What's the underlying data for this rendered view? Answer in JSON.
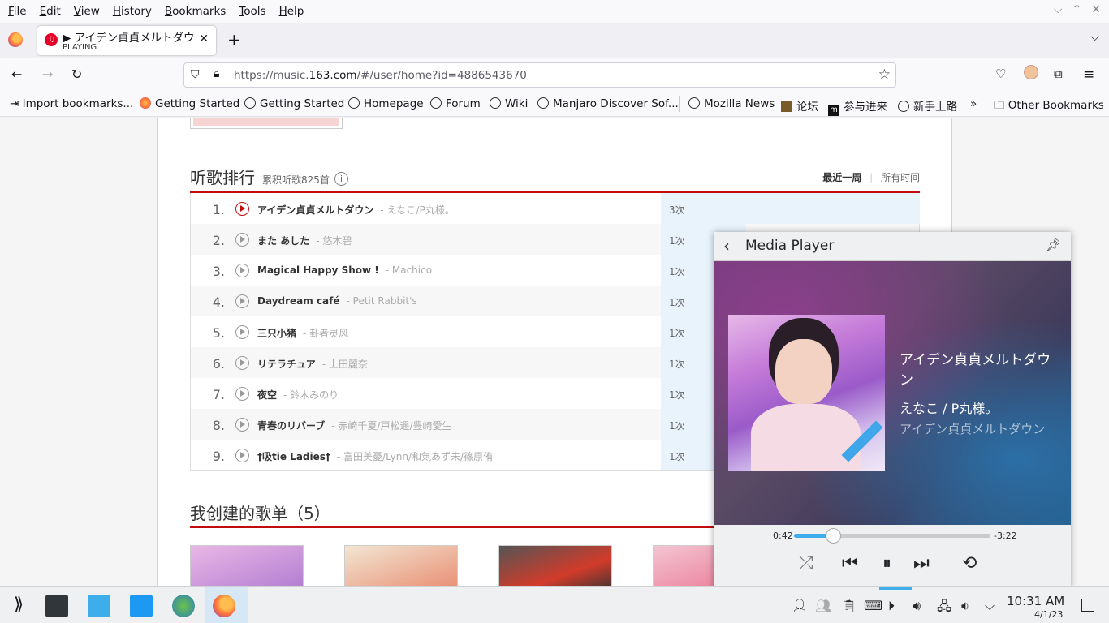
{
  "menubar": {
    "items": [
      "File",
      "Edit",
      "View",
      "History",
      "Bookmarks",
      "Tools",
      "Help"
    ],
    "underline": [
      "F",
      "E",
      "V",
      "H",
      "B",
      "T",
      "H"
    ]
  },
  "tab": {
    "title": "▶ アイデン貞貞メルトダウン",
    "subtitle": "PLAYING",
    "favicon": "netease-music-icon"
  },
  "navbar": {
    "url_prefix": "https://music.",
    "url_domain": "163.com",
    "url_path": "/#/user/home?id=4886543670"
  },
  "bookmarks": [
    {
      "label": "Import bookmarks...",
      "icon": "import-icon"
    },
    {
      "label": "Getting Started",
      "icon": "firefox-icon"
    },
    {
      "label": "Getting Started",
      "icon": "globe-icon"
    },
    {
      "label": "Homepage",
      "icon": "globe-icon"
    },
    {
      "label": "Forum",
      "icon": "globe-icon"
    },
    {
      "label": "Wiki",
      "icon": "globe-icon"
    },
    {
      "label": "Manjaro Discover Sof...",
      "icon": "globe-icon"
    },
    {
      "label": "Mozilla News",
      "icon": "globe-icon"
    },
    {
      "label": "论坛",
      "icon": "box-icon"
    },
    {
      "label": "参与进来",
      "icon": "m-icon"
    },
    {
      "label": "新手上路",
      "icon": "globe-icon"
    },
    {
      "label": "Other Bookmarks",
      "icon": "folder-icon"
    }
  ],
  "ranking": {
    "title": "听歌排行",
    "meta": "累积听歌825首",
    "info": "i",
    "period_active": "最近一周",
    "period_sep": "|",
    "period_other": "所有时间",
    "rows": [
      {
        "num": "1.",
        "song": "アイデン貞貞メルトダウン",
        "artist": "- えなこ/P丸様。",
        "count": "3次",
        "share": 1.0
      },
      {
        "num": "2.",
        "song": "また あした",
        "artist": "- 悠木碧",
        "count": "1次",
        "share": 0.33
      },
      {
        "num": "3.",
        "song": "Magical Happy Show !",
        "artist": "- Machico",
        "count": "1次",
        "share": 0.33
      },
      {
        "num": "4.",
        "song": "Daydream café",
        "artist": "- Petit Rabbit's",
        "count": "1次",
        "share": 0.33
      },
      {
        "num": "5.",
        "song": "三只小猪",
        "artist": "- 卦者灵风",
        "count": "1次",
        "share": 0.33
      },
      {
        "num": "6.",
        "song": "リテラチュア",
        "artist": "- 上田麗奈",
        "count": "1次",
        "share": 0.33
      },
      {
        "num": "7.",
        "song": "夜空",
        "artist": "- 鈴木みのり",
        "count": "1次",
        "share": 0.33
      },
      {
        "num": "8.",
        "song": "青春のリバーブ",
        "artist": "- 赤崎千夏/戸松遥/豊崎愛生",
        "count": "1次",
        "share": 0.33
      },
      {
        "num": "9.",
        "song": "†吸tie Ladies†",
        "artist": "- 富田美憂/Lynn/和氣あず未/篠原侑",
        "count": "1次",
        "share": 0.33
      }
    ]
  },
  "playlists": {
    "title": "我创建的歌单（5）"
  },
  "mediaplayer": {
    "title": "Media Player",
    "track_title": "アイデン貞貞メルトダウン",
    "artist": "えなこ / P丸様。",
    "album": "アイデン貞貞メルトダウン",
    "elapsed": "0:42",
    "remaining": "-3:22",
    "progress": 0.2
  },
  "taskbar": {
    "time": "10:31 AM",
    "date": "4/1/23"
  },
  "colors": {
    "accent": "#c20c0c",
    "kde_blue": "#3daee9"
  }
}
